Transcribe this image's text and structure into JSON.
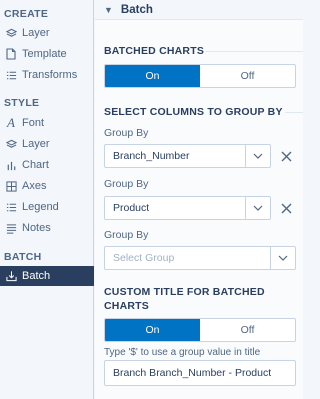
{
  "sidebar": {
    "create": {
      "title": "CREATE",
      "items": [
        {
          "label": "Layer",
          "icon": "layers-icon"
        },
        {
          "label": "Template",
          "icon": "template-icon"
        },
        {
          "label": "Transforms",
          "icon": "transforms-icon"
        }
      ]
    },
    "style": {
      "title": "STYLE",
      "items": [
        {
          "label": "Font",
          "icon": "font-icon"
        },
        {
          "label": "Layer",
          "icon": "layers-icon"
        },
        {
          "label": "Chart",
          "icon": "chart-icon"
        },
        {
          "label": "Axes",
          "icon": "axes-icon"
        },
        {
          "label": "Legend",
          "icon": "legend-icon"
        },
        {
          "label": "Notes",
          "icon": "notes-icon"
        }
      ]
    },
    "batch": {
      "title": "BATCH",
      "items": [
        {
          "label": "Batch",
          "icon": "batch-icon",
          "active": true
        }
      ]
    }
  },
  "panel": {
    "title": "Batch",
    "batched_charts": {
      "title": "BATCHED CHARTS",
      "on_label": "On",
      "off_label": "Off",
      "selected": "On"
    },
    "group_columns": {
      "title": "SELECT COLUMNS TO GROUP BY",
      "groups": [
        {
          "label": "Group By",
          "value": "Branch_Number"
        },
        {
          "label": "Group By",
          "value": "Product"
        },
        {
          "label": "Group By",
          "placeholder": "Select Group"
        }
      ]
    },
    "custom_title": {
      "title_line1": "CUSTOM TITLE FOR BATCHED",
      "title_line2": "CHARTS",
      "on_label": "On",
      "off_label": "Off",
      "selected": "On",
      "hint": "Type '$' to use a group value in title",
      "value": "Branch Branch_Number - Product"
    }
  },
  "colors": {
    "accent": "#0073c4",
    "sidebar_active": "#2a3f5f",
    "text": "#2a3f5f",
    "muted": "#506784",
    "border": "#c8d4e3"
  }
}
